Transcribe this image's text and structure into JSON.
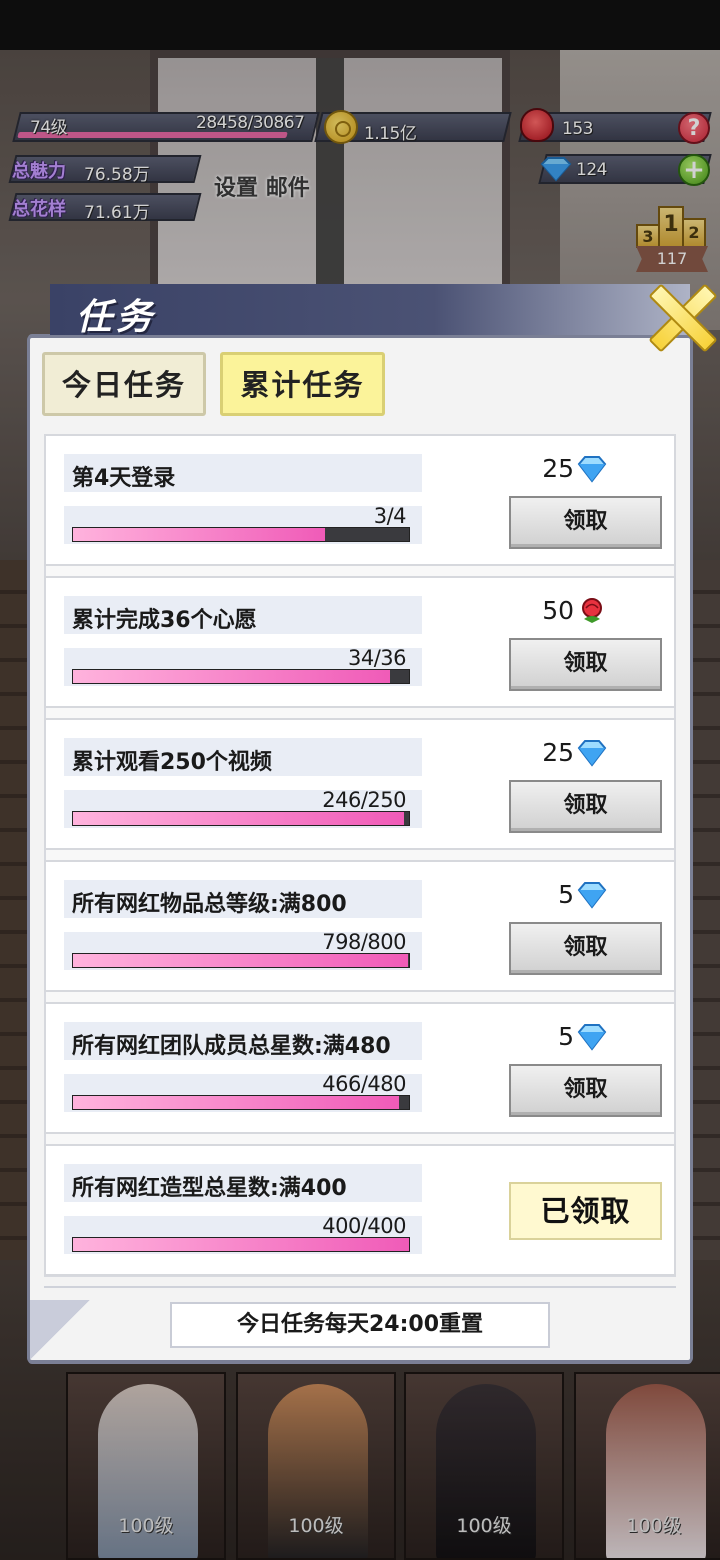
{
  "hud": {
    "level": "74级",
    "exp": "28458/30867",
    "exp_progress": 0.922,
    "coins": "1.15亿",
    "roses": "153",
    "gems": "124",
    "charm_label": "总魅力",
    "charm_value": "76.58万",
    "style_label": "总花样",
    "style_value": "71.61万",
    "settings_label": "设置",
    "mail_label": "邮件",
    "rank_value": "117",
    "podium": [
      "3",
      "1",
      "2"
    ]
  },
  "dialog": {
    "title": "任务",
    "tabs": [
      {
        "label": "今日任务",
        "active": false
      },
      {
        "label": "累计任务",
        "active": true
      }
    ],
    "claim_label": "领取",
    "claimed_label": "已领取",
    "footer_note": "今日任务每天24:00重置",
    "tasks": [
      {
        "name": "第4天登录",
        "progress_text": "3/4",
        "progress": 0.75,
        "reward": "25",
        "reward_icon": "diamond-icon",
        "status": "claimable"
      },
      {
        "name": "累计完成36个心愿",
        "progress_text": "34/36",
        "progress": 0.944,
        "reward": "50",
        "reward_icon": "rose-icon",
        "status": "claimable"
      },
      {
        "name": "累计观看250个视频",
        "progress_text": "246/250",
        "progress": 0.984,
        "reward": "25",
        "reward_icon": "diamond-icon",
        "status": "claimable"
      },
      {
        "name": "所有网红物品总等级:满800",
        "progress_text": "798/800",
        "progress": 0.9975,
        "reward": "5",
        "reward_icon": "diamond-icon",
        "status": "claimable"
      },
      {
        "name": "所有网红团队成员总星数:满480",
        "progress_text": "466/480",
        "progress": 0.971,
        "reward": "5",
        "reward_icon": "diamond-icon",
        "status": "claimable"
      },
      {
        "name": "所有网红造型总星数:满400",
        "progress_text": "400/400",
        "progress": 1.0,
        "reward": "",
        "reward_icon": "",
        "status": "claimed"
      }
    ]
  },
  "characters": [
    {
      "level": "100级"
    },
    {
      "level": "100级"
    },
    {
      "level": "100级"
    },
    {
      "level": "100级"
    }
  ],
  "colors": {
    "progress_fill": "#f05bb8",
    "active_tab": "#fbf39a",
    "dialog_header": "#3a4266"
  }
}
